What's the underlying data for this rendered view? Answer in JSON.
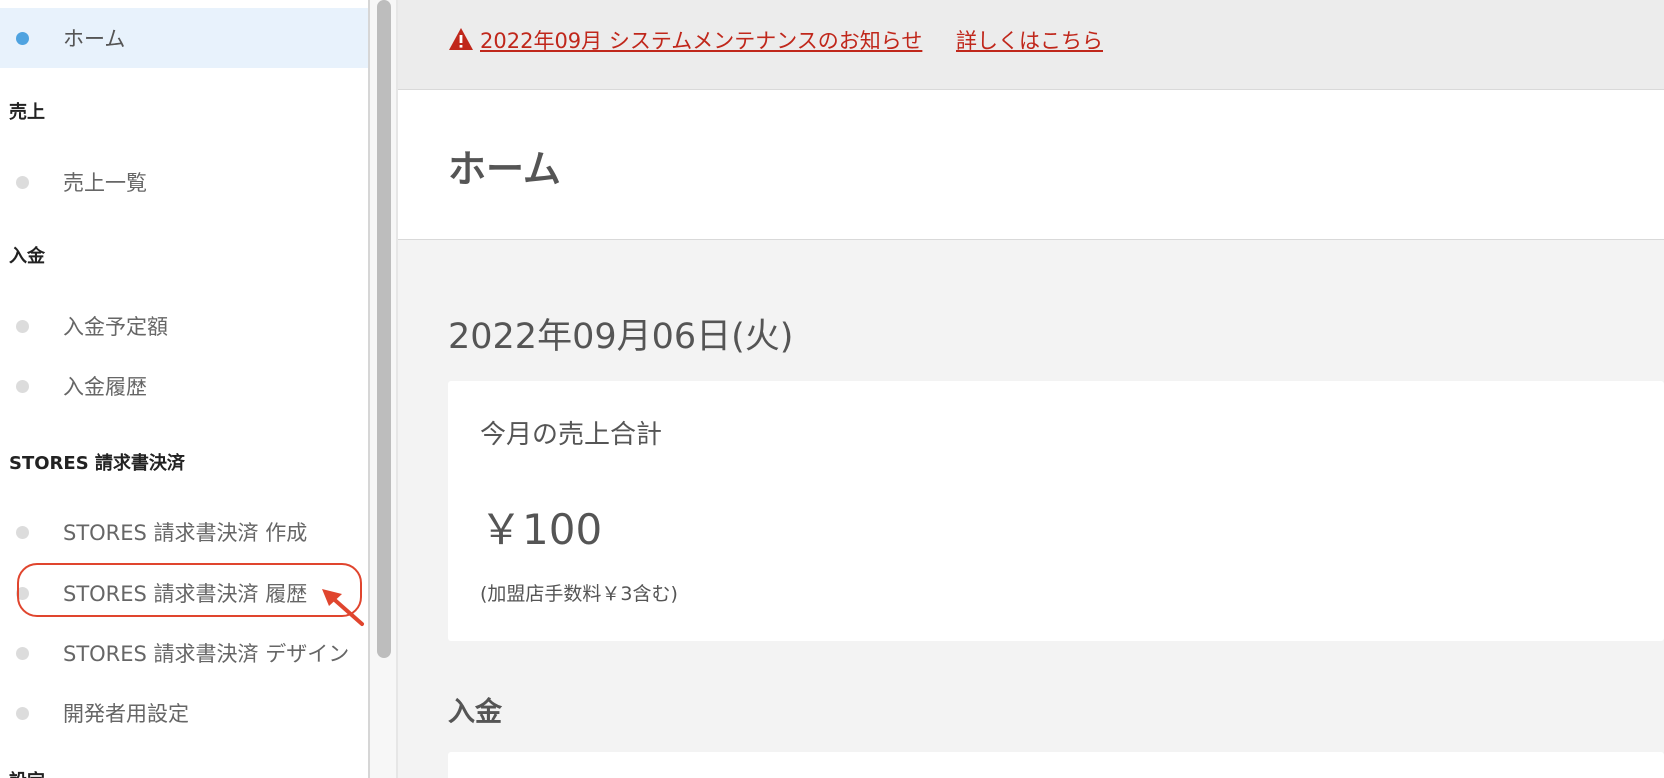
{
  "notice": {
    "text": "2022年09月 システムメンテナンスのお知らせ",
    "more": "詳しくはこちら",
    "icon": "warning-icon"
  },
  "sidebar": {
    "home": "ホーム",
    "sections": {
      "sales": "売上",
      "deposit": "入金",
      "invoice": "STORES 請求書決済",
      "settings": "設定"
    },
    "items": {
      "sales_list": "売上一覧",
      "deposit_scheduled": "入金予定額",
      "deposit_history": "入金履歴",
      "invoice_create": "STORES 請求書決済 作成",
      "invoice_history": "STORES 請求書決済 履歴",
      "invoice_design": "STORES 請求書決済 デザイン",
      "developer": "開発者用設定"
    }
  },
  "main": {
    "title": "ホーム",
    "date": "2022年09月06日(火)",
    "card": {
      "title": "今月の売上合計",
      "amount": "￥100",
      "note": "(加盟店手数料￥3含む)"
    },
    "section2": "入金"
  },
  "colors": {
    "accent_dot": "#4fa3e0",
    "notice_link": "#c0271b",
    "highlight": "#e0452e"
  }
}
